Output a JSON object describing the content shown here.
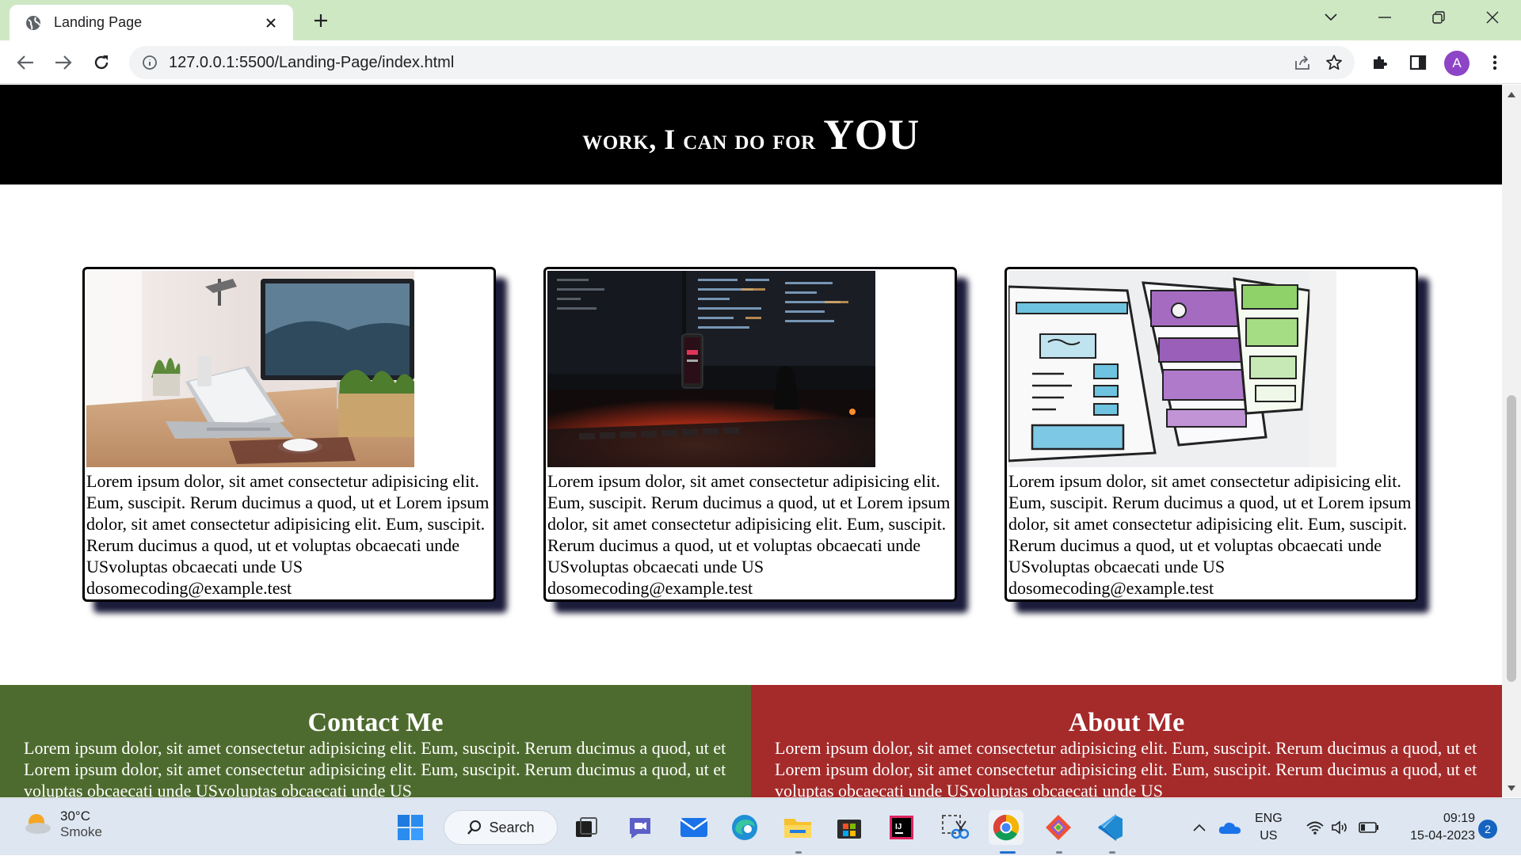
{
  "browser": {
    "tab_title": "Landing Page",
    "url": "127.0.0.1:5500/Landing-Page/index.html",
    "profile_initial": "A",
    "icons": [
      "globe-icon",
      "close-icon",
      "plus-icon",
      "chevron-down-icon",
      "minimize-icon",
      "restore-icon",
      "window-close-icon",
      "back-arrow-icon",
      "forward-arrow-icon",
      "reload-icon",
      "info-icon",
      "share-icon",
      "star-icon",
      "extensions-icon",
      "side-panel-icon",
      "kebab-menu-icon"
    ]
  },
  "page": {
    "header": {
      "prefix": "work, I can do for",
      "emphasis": "YOU"
    },
    "cards": [
      {
        "image": "desk-laptop-photo",
        "text": "Lorem ipsum dolor, sit amet consectetur adipisicing elit. Eum, suscipit. Rerum ducimus a quod, ut et Lorem ipsum dolor, sit amet consectetur adipisicing elit. Eum, suscipit. Rerum ducimus a quod, ut et voluptas obcaecati unde USvoluptas obcaecati unde US dosomecoding@example.test"
      },
      {
        "image": "code-screen-phone-photo",
        "text": "Lorem ipsum dolor, sit amet consectetur adipisicing elit. Eum, suscipit. Rerum ducimus a quod, ut et Lorem ipsum dolor, sit amet consectetur adipisicing elit. Eum, suscipit. Rerum ducimus a quod, ut et voluptas obcaecati unde USvoluptas obcaecati unde US dosomecoding@example.test"
      },
      {
        "image": "wireframe-sketch-photo",
        "text": "Lorem ipsum dolor, sit amet consectetur adipisicing elit. Eum, suscipit. Rerum ducimus a quod, ut et Lorem ipsum dolor, sit amet consectetur adipisicing elit. Eum, suscipit. Rerum ducimus a quod, ut et voluptas obcaecati unde USvoluptas obcaecati unde US dosomecoding@example.test"
      }
    ],
    "contact": {
      "title": "Contact Me",
      "text": "Lorem ipsum dolor, sit amet consectetur adipisicing elit. Eum, suscipit. Rerum ducimus a quod, ut et Lorem ipsum dolor, sit amet consectetur adipisicing elit. Eum, suscipit. Rerum ducimus a quod, ut et voluptas obcaecati unde USvoluptas obcaecati unde US",
      "color": "#4e6b2f"
    },
    "about": {
      "title": "About Me",
      "text": "Lorem ipsum dolor, sit amet consectetur adipisicing elit. Eum, suscipit. Rerum ducimus a quod, ut et Lorem ipsum dolor, sit amet consectetur adipisicing elit. Eum, suscipit. Rerum ducimus a quod, ut et voluptas obcaecati unde USvoluptas obcaecati unde US",
      "color": "#a52a2a"
    }
  },
  "taskbar": {
    "weather": {
      "temp": "30°C",
      "condition": "Smoke"
    },
    "search_label": "Search",
    "apps": [
      "windows-start-icon",
      "search-icon",
      "task-view-icon",
      "teams-meet-icon",
      "mail-icon",
      "edge-icon",
      "file-explorer-icon",
      "microsoft-store-icon",
      "intellij-icon",
      "snipping-tool-icon",
      "chrome-icon",
      "git-icon",
      "vscode-icon"
    ],
    "language": {
      "line1": "ENG",
      "line2": "US"
    },
    "time": "09:19",
    "date": "15-04-2023",
    "notification_count": "2"
  }
}
